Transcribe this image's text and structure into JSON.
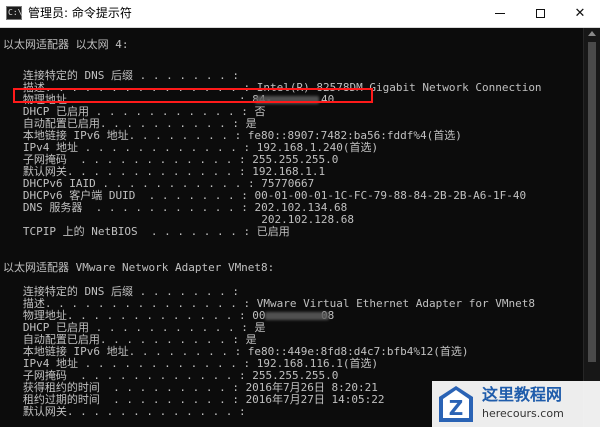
{
  "window": {
    "icon_text": "C:\\",
    "title": "管理员: 命令提示符",
    "minimize": "minimize",
    "maximize": "maximize",
    "close": "✕"
  },
  "console": {
    "lines": [
      [
        "以太网适配器 以太网 4:"
      ],
      [
        ""
      ],
      [
        "   连接特定的 DNS 后缀 . . . . . . . : "
      ],
      [
        "   描述. . . . . . . . . . . . . . . : Intel(R) 82578DM Gigabit Network Connection"
      ],
      [
        "   物理地址. . . . . . . . . . . . . : 84-",
        "40"
      ],
      [
        "   DHCP 已启用 . . . . . . . . . . . : 否"
      ],
      [
        "   自动配置已启用. . . . . . . . . . : 是"
      ],
      [
        "   本地链接 IPv6 地址. . . . . . . . : fe80::8907:7482:ba56:fddf%4(首选)"
      ],
      [
        "   IPv4 地址 . . . . . . . . . . . . : 192.168.1.240(首选)"
      ],
      [
        "   子网掩码  . . . . . . . . . . . . : 255.255.255.0"
      ],
      [
        "   默认网关. . . . . . . . . . . . . : 192.168.1.1"
      ],
      [
        "   DHCPv6 IAID . . . . . . . . . . . : 75770667"
      ],
      [
        "   DHCPv6 客户端 DUID  . . . . . . . : 00-01-00-01-1C-FC-79-88-84-2B-2B-A6-1F-40"
      ],
      [
        "   DNS 服务器  . . . . . . . . . . . : 202.102.134.68"
      ],
      [
        "                                       202.102.128.68"
      ],
      [
        "   TCPIP 上的 NetBIOS  . . . . . . . : 已启用"
      ],
      [
        ""
      ],
      [
        "以太网适配器 VMware Network Adapter VMnet8:"
      ],
      [
        ""
      ],
      [
        "   连接特定的 DNS 后缀 . . . . . . . : "
      ],
      [
        "   描述. . . . . . . . . . . . . . . : VMware Virtual Ethernet Adapter for VMnet8"
      ],
      [
        "   物理地址. . . . . . . . . . . . . : 00",
        "08"
      ],
      [
        "   DHCP 已启用 . . . . . . . . . . . : 是"
      ],
      [
        "   自动配置已启用. . . . . . . . . . : 是"
      ],
      [
        "   本地链接 IPv6 地址. . . . . . . . : fe80::449e:8fd8:d4c7:bfb4%12(首选)"
      ],
      [
        "   IPv4 地址 . . . . . . . . . . . . : 192.168.116.1(首选)"
      ],
      [
        "   子网掩码  . . . . . . . . . . . . : 255.255.255.0"
      ],
      [
        "   获得租约的时间  . . . . . . . . . : 2016年7月26日 8:20:21"
      ],
      [
        "   租约过期的时间  . . . . . . . . . : 2016年7月27日 14:05:22"
      ],
      [
        "   默认网关. . . . . . . . . . . . . : "
      ]
    ]
  },
  "watermark": {
    "name": "这里教程网",
    "url": "herecours.com",
    "badge_letter": "Z"
  }
}
